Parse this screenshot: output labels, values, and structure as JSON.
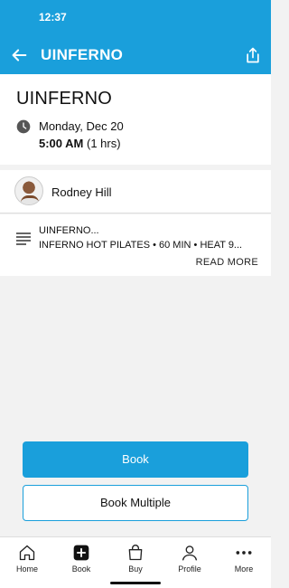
{
  "status_bar": {
    "time": "12:37"
  },
  "app_bar": {
    "title": "UINFERNO",
    "back_icon": "arrow-left-icon",
    "share_icon": "share-icon"
  },
  "class_info": {
    "title": "UINFERNO",
    "date": "Monday, Dec 20",
    "time": "5:00 AM",
    "duration": " (1 hrs)"
  },
  "instructor": {
    "name": "Rodney Hill"
  },
  "description": {
    "title": "UINFERNO...",
    "body": "INFERNO HOT PILATES • 60 MIN • HEAT 9...",
    "read_more": "READ MORE"
  },
  "actions": {
    "book": "Book",
    "book_multiple": "Book Multiple"
  },
  "tabs": [
    {
      "label": "Home",
      "icon": "home-icon"
    },
    {
      "label": "Book",
      "icon": "plus-square-icon"
    },
    {
      "label": "Buy",
      "icon": "shopping-bag-icon"
    },
    {
      "label": "Profile",
      "icon": "user-icon"
    },
    {
      "label": "More",
      "icon": "more-dots-icon"
    }
  ],
  "colors": {
    "accent": "#1a9fdb",
    "background": "#f2f2f2"
  }
}
